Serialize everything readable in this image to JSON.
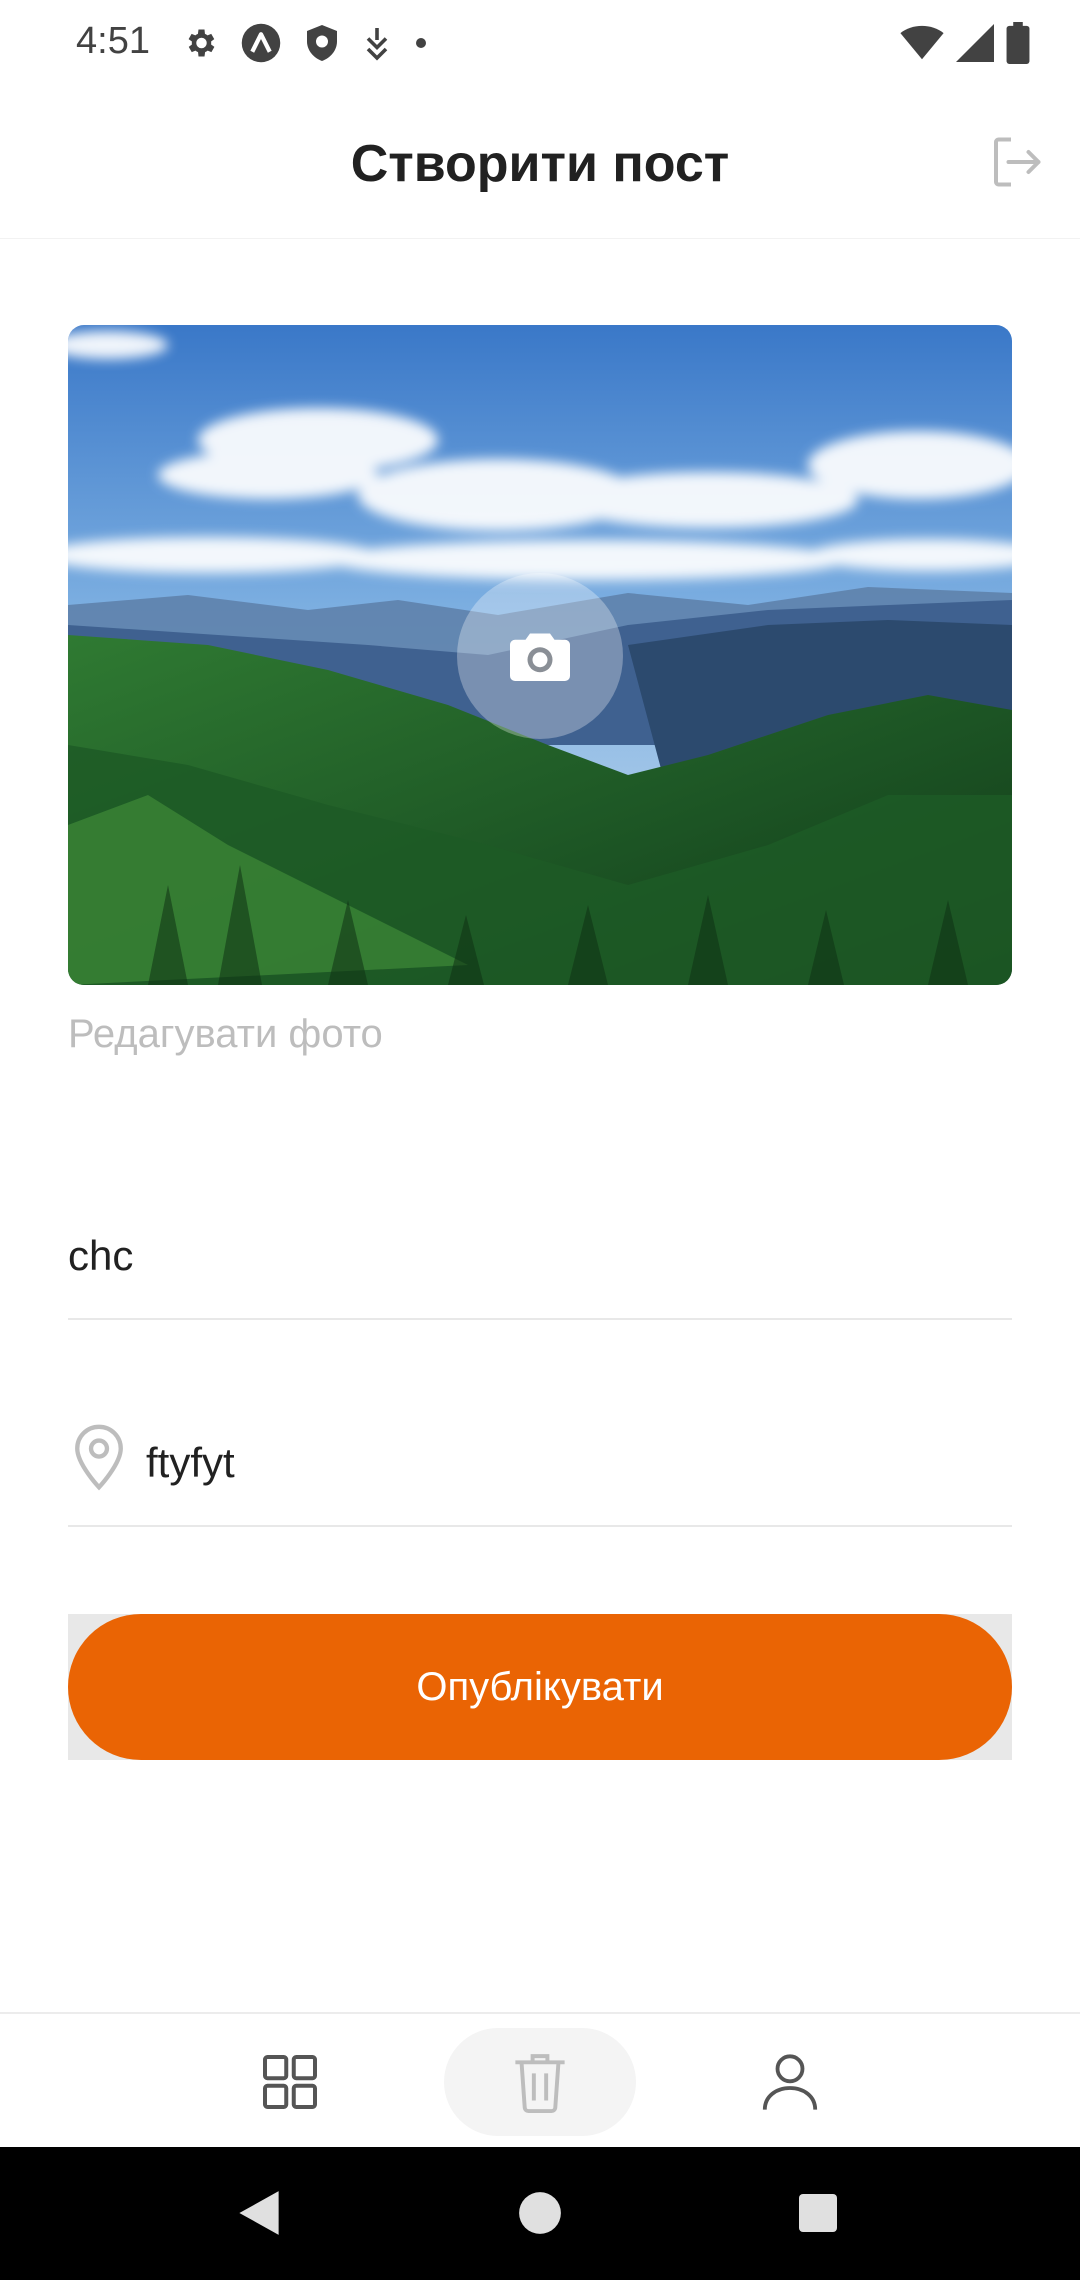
{
  "status_bar": {
    "time": "4:51",
    "left_icons": [
      "gear-icon",
      "app-a-icon",
      "shield-icon",
      "download-arrow-icon",
      "dot-icon"
    ],
    "right_icons": [
      "wifi-icon",
      "cell-signal-icon",
      "battery-icon"
    ]
  },
  "header": {
    "title": "Створити пост",
    "logout_icon": "logout-icon"
  },
  "photo": {
    "camera_icon": "camera-icon",
    "edit_label": "Редагувати фото"
  },
  "form": {
    "title_value": "chc",
    "location_value": "ftyfyt",
    "location_icon": "map-pin-icon"
  },
  "actions": {
    "publish_label": "Опублікувати"
  },
  "tab_bar": {
    "tabs": [
      "grid-icon",
      "trash-icon",
      "user-icon"
    ],
    "active": "trash-icon"
  },
  "colors": {
    "accent": "#ea6404",
    "muted_text": "#bdbdbd",
    "divider": "#e8e8e8"
  }
}
